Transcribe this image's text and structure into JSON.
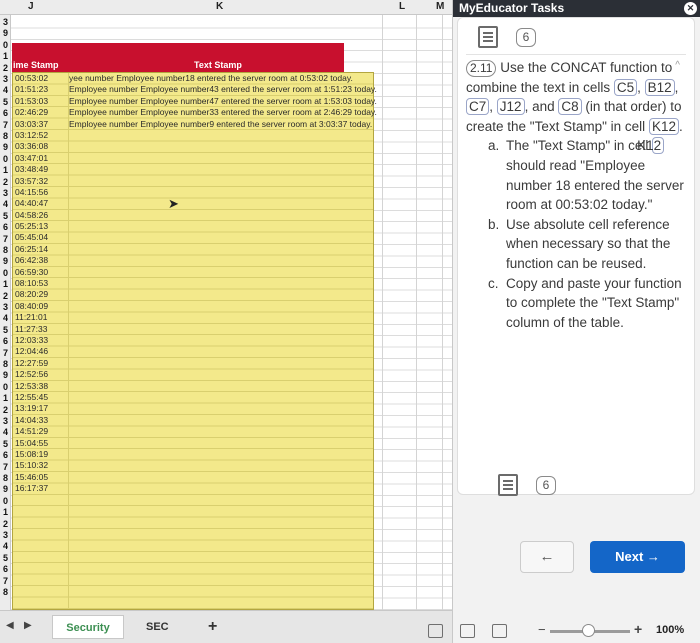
{
  "sheet": {
    "column_letters": [
      "J",
      "K",
      "L",
      "M"
    ],
    "row_numbers": [
      "3",
      "9",
      "0",
      "1",
      "2",
      "3",
      "4",
      "5",
      "6",
      "7",
      "8",
      "9",
      "0",
      "1",
      "2",
      "3",
      "4",
      "5",
      "6",
      "7",
      "8",
      "9",
      "0",
      "1",
      "2",
      "3",
      "4",
      "5",
      "6",
      "7",
      "8",
      "9",
      "0",
      "1",
      "2",
      "3",
      "4",
      "5",
      "6",
      "7",
      "8",
      "9",
      "0",
      "1",
      "2",
      "3",
      "4",
      "5",
      "6",
      "7",
      "8"
    ],
    "headers": {
      "time_stamp": "ime Stamp",
      "text_stamp": "Text Stamp"
    },
    "rows": [
      {
        "time": "00:53:02",
        "text": "yee number Employee number18 entered the server room at 0:53:02 today."
      },
      {
        "time": "01:51:23",
        "text": "Employee number Employee number43 entered the server room at 1:51:23 today."
      },
      {
        "time": "01:53:03",
        "text": "Employee number Employee number47 entered the server room at 1:53:03 today."
      },
      {
        "time": "02:46:29",
        "text": "Employee number Employee number33 entered the server room at 2:46:29 today."
      },
      {
        "time": "03:03:37",
        "text": "Employee number Employee number9 entered the server room at 3:03:37 today."
      },
      {
        "time": "03:12:52",
        "text": ""
      },
      {
        "time": "03:36:08",
        "text": ""
      },
      {
        "time": "03:47:01",
        "text": ""
      },
      {
        "time": "03:48:49",
        "text": ""
      },
      {
        "time": "03:57:32",
        "text": ""
      },
      {
        "time": "04:15:56",
        "text": ""
      },
      {
        "time": "04:40:47",
        "text": ""
      },
      {
        "time": "04:58:26",
        "text": ""
      },
      {
        "time": "05:25:13",
        "text": ""
      },
      {
        "time": "05:45:04",
        "text": ""
      },
      {
        "time": "06:25:14",
        "text": ""
      },
      {
        "time": "06:42:38",
        "text": ""
      },
      {
        "time": "06:59:30",
        "text": ""
      },
      {
        "time": "08:10:53",
        "text": ""
      },
      {
        "time": "08:20:29",
        "text": ""
      },
      {
        "time": "08:40:09",
        "text": ""
      },
      {
        "time": "11:21:01",
        "text": ""
      },
      {
        "time": "11:27:33",
        "text": ""
      },
      {
        "time": "12:03:33",
        "text": ""
      },
      {
        "time": "12:04:46",
        "text": ""
      },
      {
        "time": "12:27:59",
        "text": ""
      },
      {
        "time": "12:52:56",
        "text": ""
      },
      {
        "time": "12:53:38",
        "text": ""
      },
      {
        "time": "12:55:45",
        "text": ""
      },
      {
        "time": "13:19:17",
        "text": ""
      },
      {
        "time": "14:04:33",
        "text": ""
      },
      {
        "time": "14:51:29",
        "text": ""
      },
      {
        "time": "15:04:55",
        "text": ""
      },
      {
        "time": "15:08:19",
        "text": ""
      },
      {
        "time": "15:10:32",
        "text": ""
      },
      {
        "time": "15:46:05",
        "text": ""
      },
      {
        "time": "16:17:37",
        "text": ""
      }
    ]
  },
  "tabs": {
    "nav_prev": "◀",
    "nav_next": "▶",
    "sheet_tab": "Security",
    "second_tab": "SEC",
    "add": "+"
  },
  "panel": {
    "title": "MyEducator Tasks",
    "close": "✕",
    "step_count": "6",
    "step_count_bottom": "6",
    "collapse_icon": "^",
    "task_number": "2.11",
    "task_intro_1": "Use the CONCAT function to combine the text in cells",
    "cells": [
      "C5",
      "B12",
      "C7",
      "J12"
    ],
    "task_intro_2": "and",
    "cell_c8": "C8",
    "task_intro_3": "(in that order) to create the \"Text Stamp\" in cell",
    "cell_k12": "K12",
    "sub_a_label": "a.",
    "sub_a_1": "The \"Text Stamp\" in cell",
    "sub_a_cell": "K12",
    "sub_a_2": "should read \"Employee number 18 entered the server room at 00:53:02 today.\"",
    "sub_b_label": "b.",
    "sub_b": "Use absolute cell reference when necessary so that the function can be reused.",
    "sub_c_label": "c.",
    "sub_c": "Copy and paste your function to complete the \"Text Stamp\" column of the table.",
    "prev_button": "←",
    "next_button": "Next →"
  },
  "status": {
    "zoom": "100%",
    "minus": "−",
    "plus": "+"
  }
}
